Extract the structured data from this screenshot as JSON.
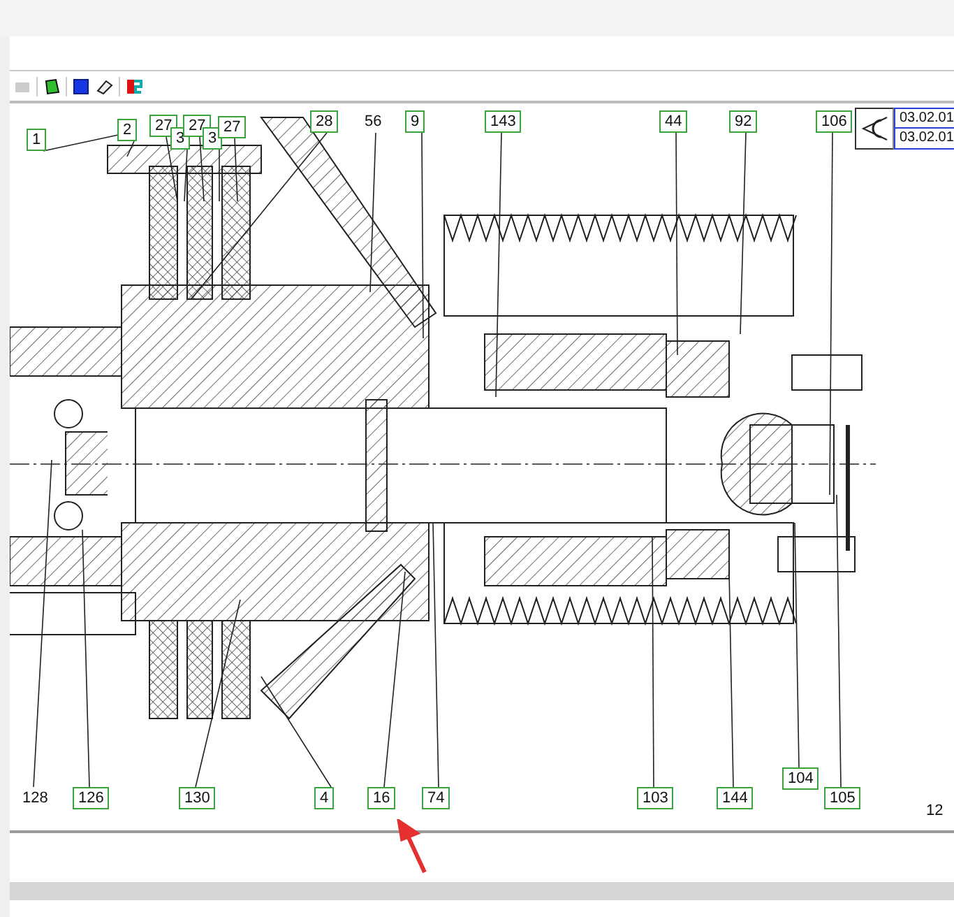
{
  "labels": [
    {
      "text": "1",
      "boxed": true
    },
    {
      "text": "2",
      "boxed": true
    },
    {
      "text": "27",
      "boxed": true
    },
    {
      "text": "3",
      "boxed": true
    },
    {
      "text": "27",
      "boxed": true
    },
    {
      "text": "3",
      "boxed": true
    },
    {
      "text": "27",
      "boxed": true
    },
    {
      "text": "28",
      "boxed": true
    },
    {
      "text": "56",
      "boxed": false
    },
    {
      "text": "9",
      "boxed": true
    },
    {
      "text": "143",
      "boxed": true
    },
    {
      "text": "44",
      "boxed": true
    },
    {
      "text": "92",
      "boxed": true
    },
    {
      "text": "106",
      "boxed": true
    },
    {
      "text": "128",
      "boxed": false
    },
    {
      "text": "126",
      "boxed": true
    },
    {
      "text": "130",
      "boxed": true
    },
    {
      "text": "4",
      "boxed": true
    },
    {
      "text": "16",
      "boxed": true
    },
    {
      "text": "74",
      "boxed": true
    },
    {
      "text": "103",
      "boxed": true
    },
    {
      "text": "144",
      "boxed": true
    },
    {
      "text": "104",
      "boxed": true
    },
    {
      "text": "105",
      "boxed": true
    },
    {
      "text": "12",
      "boxed": false
    }
  ],
  "view_reference": {
    "codes": [
      "03.02.01",
      "03.02.01"
    ]
  }
}
